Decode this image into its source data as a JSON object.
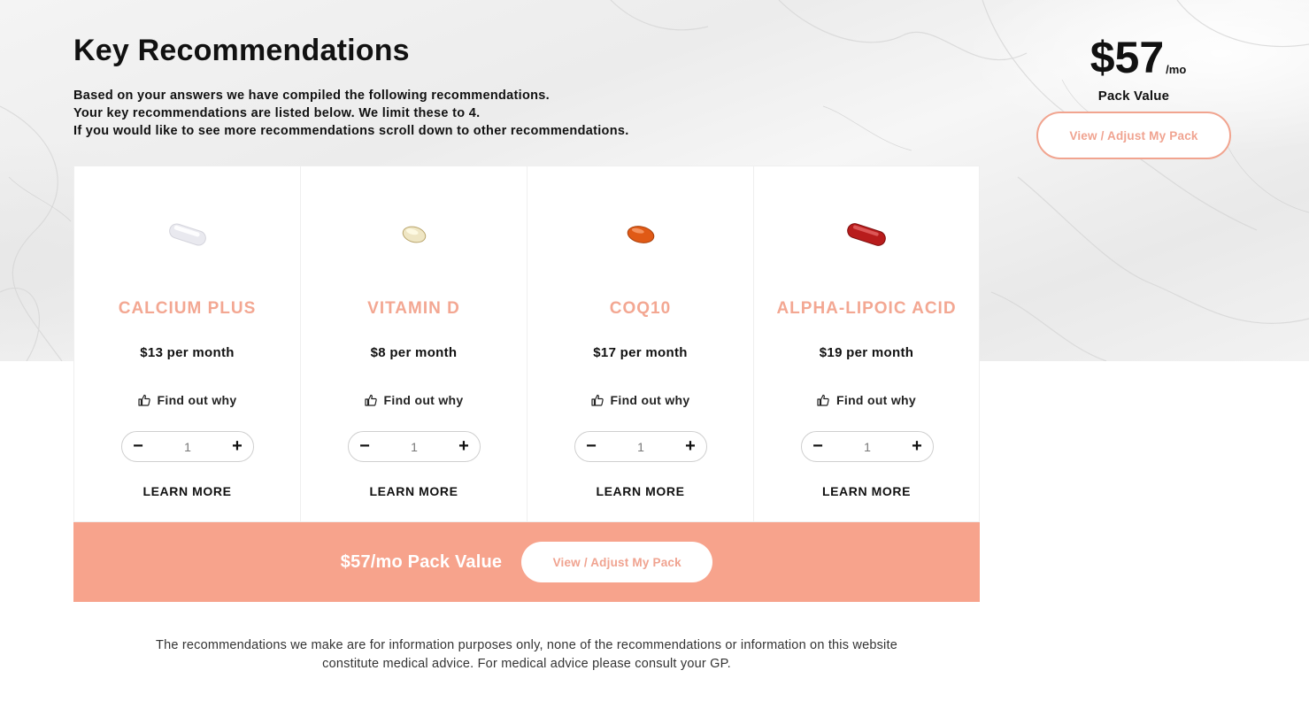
{
  "header": {
    "title": "Key Recommendations",
    "intro_lines": [
      "Based on your answers we have compiled the following recommendations.",
      "Your key recommendations are listed below. We limit these to 4.",
      "If you would like to see more recommendations scroll down to other recommendations."
    ]
  },
  "summary": {
    "price": "$57",
    "per": "/mo",
    "label": "Pack Value",
    "button": "View / Adjust My Pack"
  },
  "products": [
    {
      "name": "CALCIUM PLUS",
      "price": "$13 per month",
      "find_label": "Find out why",
      "quantity": "1",
      "learn": "LEARN MORE",
      "pill_icon": "white-tablet-icon",
      "pill_color": "#f2f2f6"
    },
    {
      "name": "VITAMIN D",
      "price": "$8 per month",
      "find_label": "Find out why",
      "quantity": "1",
      "learn": "LEARN MORE",
      "pill_icon": "softgel-cream-icon",
      "pill_color": "#efe6c4"
    },
    {
      "name": "COQ10",
      "price": "$17 per month",
      "find_label": "Find out why",
      "quantity": "1",
      "learn": "LEARN MORE",
      "pill_icon": "softgel-orange-icon",
      "pill_color": "#e05a16"
    },
    {
      "name": "ALPHA-LIPOIC ACID",
      "price": "$19 per month",
      "find_label": "Find out why",
      "quantity": "1",
      "learn": "LEARN MORE",
      "pill_icon": "capsule-red-icon",
      "pill_color": "#b81c1c"
    }
  ],
  "bottom_bar": {
    "text": "$57/mo Pack Value",
    "button": "View / Adjust My Pack",
    "color": "#f7a38c"
  },
  "disclaimer": {
    "line1": "The recommendations we make are for information purposes only, none of the recommendations or information on this website",
    "line2": "constitute medical advice. For medical advice please consult your GP."
  },
  "colors": {
    "accent": "#f3a792",
    "text": "#111111"
  }
}
